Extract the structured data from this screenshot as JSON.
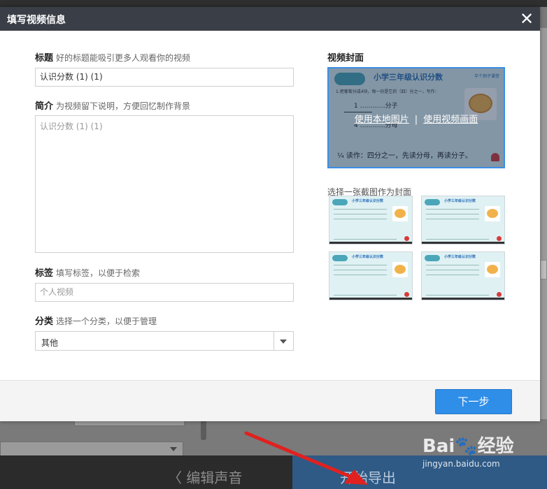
{
  "dialog": {
    "title": "填写视频信息",
    "close_glyph": "✕"
  },
  "form": {
    "title_label": "标题",
    "title_hint": "好的标题能吸引更多人观看你的视频",
    "title_value": "认识分数 (1) (1)",
    "intro_label": "简介",
    "intro_hint": "为视频留下说明，方便回忆制作背景",
    "intro_value": "认识分数 (1) (1)",
    "tags_label": "标签",
    "tags_hint": "填写标签，以便于检索",
    "tags_placeholder": "个人视频",
    "category_label": "分类",
    "category_hint": "选择一个分类，以便于管理",
    "category_value": "其他"
  },
  "cover": {
    "title": "视频封面",
    "use_local_image": "使用本地图片",
    "separator": "|",
    "use_video_frame": "使用视频画面",
    "screenshot_label": "选择一张截图作为封面",
    "slide_title": "小学三年级认识分数",
    "slide_tag": "半个例子课堂",
    "slide_line": "1.把葡萄分成4块，每一份是它的（四）分之一，写作：",
    "slide_num": "1",
    "slide_num_label": "…………分子",
    "slide_den": "4",
    "slide_den_label": "…………分母",
    "slide_bottom": "¼ 读作：四分之一，先读分母，再读分子。",
    "thumbnails": [
      "thumb-1",
      "thumb-2",
      "thumb-3",
      "thumb-4"
    ]
  },
  "footer": {
    "next_label": "下一步"
  },
  "background": {
    "edit_sound": "〈 编辑声音",
    "start_export": "开始导出"
  },
  "watermark": {
    "brand": "Bai🐾经验",
    "url": "jingyan.baidu.com"
  },
  "colors": {
    "header": "#3a3f47",
    "primary_button": "#2f8ee8",
    "cover_border": "#3a8ee6",
    "annotation_arrow": "#e0211f"
  }
}
